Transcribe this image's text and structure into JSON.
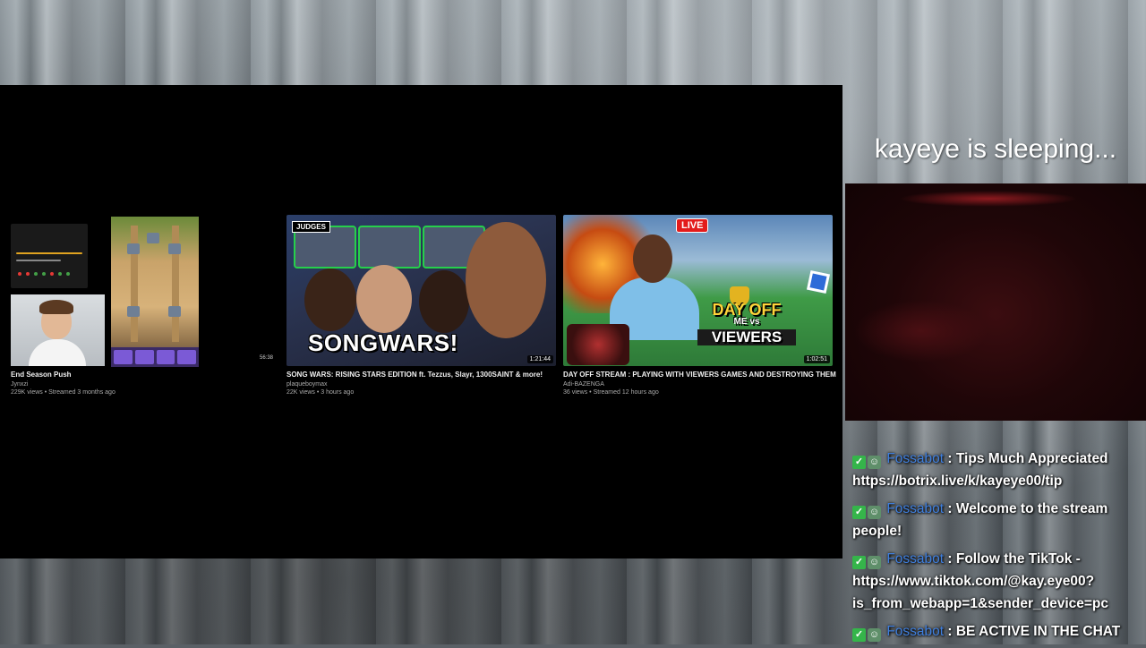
{
  "overlay": {
    "status_text": "kayeye is sleeping..."
  },
  "videos": [
    {
      "title": "End Season Push",
      "channel": "Jynxzi",
      "meta": "229K views • Streamed 3 months ago",
      "duration": "56:38"
    },
    {
      "title": "SONG WARS: RISING STARS EDITION ft. Tezzus, Slayr, 1300SAINT & more!",
      "channel": "plaqueboymax",
      "meta": "22K views • 3 hours ago",
      "duration": "1:21:44",
      "thumb_judges": "JUDGES",
      "thumb_text": "SONGWARS!"
    },
    {
      "title": "DAY OFF STREAM : PLAYING WITH VIEWERS GAMES AND DESTROYING THEM",
      "channel": "Adi-BAZENGA",
      "meta": "36 views • Streamed 12 hours ago",
      "duration": "1:02:51",
      "thumb_live": "LIVE",
      "thumb_dayoff": "DAY OFF",
      "thumb_vs": "ME vs",
      "thumb_viewers": "VIEWERS"
    }
  ],
  "chat": [
    {
      "badges": [
        "mod-icon",
        "bot-icon"
      ],
      "user": "Fossabot",
      "text": ": Tips Much Appreciated https://botrix.live/k/kayeye00/tip"
    },
    {
      "badges": [
        "mod-icon",
        "bot-icon"
      ],
      "user": "Fossabot",
      "text": ": Welcome to the stream people!"
    },
    {
      "badges": [
        "mod-icon",
        "bot-icon"
      ],
      "user": "Fossabot",
      "text": ": Follow the TikTok - https://www.tiktok.com/@kay.eye00?is_from_webapp=1&sender_device=pc"
    },
    {
      "badges": [
        "mod-icon",
        "bot-icon"
      ],
      "user": "Fossabot",
      "text": ": BE ACTIVE IN THE CHAT"
    }
  ],
  "colors": {
    "username": "#3f7fde",
    "mod_badge": "#35b54a",
    "live_badge": "#e31b1b"
  }
}
